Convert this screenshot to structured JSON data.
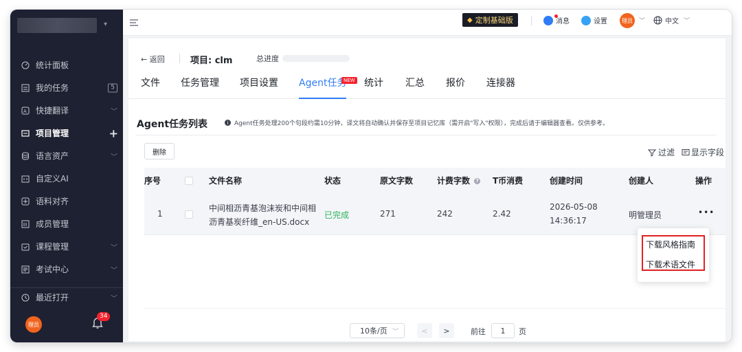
{
  "sidebar": {
    "items": [
      {
        "label": "统计面板",
        "icon": "dashboard-icon"
      },
      {
        "label": "我的任务",
        "icon": "task-icon",
        "badge": "5"
      },
      {
        "label": "快捷翻译",
        "icon": "translate-icon"
      },
      {
        "label": "项目管理",
        "icon": "folder-icon"
      },
      {
        "label": "语言资产",
        "icon": "database-icon"
      },
      {
        "label": "自定义AI",
        "icon": "ai-icon"
      },
      {
        "label": "语料对齐",
        "icon": "align-icon"
      },
      {
        "label": "成员管理",
        "icon": "members-icon"
      },
      {
        "label": "课程管理",
        "icon": "course-icon"
      },
      {
        "label": "考试中心",
        "icon": "exam-icon"
      },
      {
        "label": "最近打开",
        "icon": "history-icon"
      }
    ],
    "avatar_text": "理员",
    "bell_badge": "34"
  },
  "header": {
    "custom_button": "定制基础版",
    "messages": "消息",
    "settings": "设置",
    "avatar_text": "理员",
    "language": "中文"
  },
  "project": {
    "back": "← 返回",
    "name": "项目: clm",
    "progress_label": "总进度",
    "tabs": [
      "文件",
      "任务管理",
      "项目设置",
      "Agent任务",
      "统计",
      "汇总",
      "报价",
      "连接器"
    ],
    "active_tab": "Agent任务",
    "new_badge": "NEW"
  },
  "agent_list": {
    "title": "Agent任务列表",
    "info": "Agent任务处理200个句段约需10分钟，译文将自动确认并保存至项目记忆库（需开启\"写入\"权限），完成后请于编辑器查看。仅供参考。",
    "delete_button": "删除",
    "filter_label": "过滤",
    "display_fields_label": "显示字段",
    "columns": [
      "序号",
      "文件名称",
      "状态",
      "原文字数",
      "计费字数",
      "T币消费",
      "创建时间",
      "创建人",
      "操作"
    ],
    "rows": [
      {
        "index": "1",
        "file_line1": "中间相沥青基泡沫炭和中间相",
        "file_line2": "沥青基炭纤维_en-US.docx",
        "status": "已完成",
        "source_words": "271",
        "billed_words": "242",
        "t_coins": "2.42",
        "created_date": "2026-05-08",
        "created_time": "14:36:17",
        "creator": "明管理员",
        "actions": "•••"
      }
    ],
    "dropdown": [
      "下载风格指南",
      "下载术语文件"
    ]
  },
  "pagination": {
    "page_size": "10条/页",
    "prev": "<",
    "next": ">",
    "goto_label": "前往",
    "goto_value": "1",
    "page_suffix": "页"
  },
  "colors": {
    "sidebar_bg": "#1e2131",
    "accent": "#2f7df6",
    "success": "#2bb35b",
    "highlight": "#e02020"
  }
}
